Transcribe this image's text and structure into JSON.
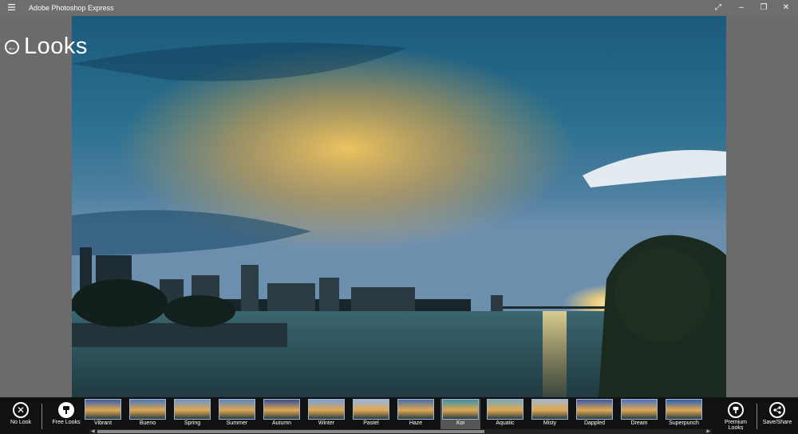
{
  "window": {
    "title": "Adobe Photoshop Express",
    "controls": {
      "fullscreen_icon": "expand-icon",
      "minimize_icon": "minimize-icon",
      "restore_icon": "restore-icon",
      "close_icon": "close-icon"
    }
  },
  "header": {
    "back_icon": "back-arrow-icon",
    "title": "Looks"
  },
  "photo": {
    "description": "",
    "alt": ""
  },
  "bottom": {
    "no_look": "No Look",
    "free_looks": "Free Looks",
    "premium_looks": "Premium Looks",
    "save_share": "Save/Share",
    "looks": [
      {
        "label": "Vibrant",
        "color": "#3c5fa8"
      },
      {
        "label": "Bueno",
        "color": "#4a78b8"
      },
      {
        "label": "Spring",
        "color": "#6c94c6"
      },
      {
        "label": "Summer",
        "color": "#5a86c0"
      },
      {
        "label": "Autumn",
        "color": "#3b4f8f"
      },
      {
        "label": "Winter",
        "color": "#7aa0d0"
      },
      {
        "label": "Pastel",
        "color": "#9bb8dc"
      },
      {
        "label": "Haze",
        "color": "#4a6ca8"
      },
      {
        "label": "Koi",
        "color": "#3e8fa3"
      },
      {
        "label": "Aquatic",
        "color": "#79a8b8"
      },
      {
        "label": "Misty",
        "color": "#a8b8c8"
      },
      {
        "label": "Dappled",
        "color": "#3c58a4"
      },
      {
        "label": "Dream",
        "color": "#4a72c0"
      },
      {
        "label": "Superpunch",
        "color": "#2e5fb2"
      }
    ],
    "selected_index": 8
  },
  "colors": {
    "titlebar": "#6e6e6e",
    "bottombar": "#111111",
    "accent": "#9bb6d8"
  }
}
